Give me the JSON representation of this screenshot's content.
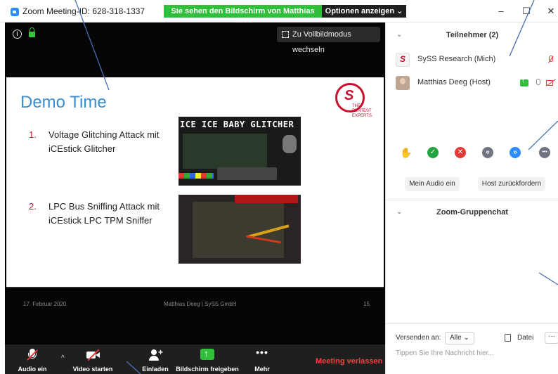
{
  "window": {
    "title": "Zoom Meeting-ID: 628-318-1337",
    "share_banner": "Sie sehen den Bildschirm von Matthias Deeg",
    "options_button": "Optionen anzeigen ⌄",
    "minimize": "–",
    "maximize": "☐",
    "close": "✕"
  },
  "stage": {
    "fullscreen_button": "Zu Vollbildmodus wechseln",
    "info_glyph": "i"
  },
  "slide": {
    "title": "Demo Time",
    "logo_mark": "S",
    "logo_text": "THE PENTEST EXPERTS.",
    "items": [
      {
        "num": "1.",
        "text": "Voltage Glitching Attack mit iCEstick Glitcher"
      },
      {
        "num": "2.",
        "text": "LPC Bus Sniffing Attack mit iCEstick LPC TPM Sniffer"
      }
    ],
    "screenshot1_text": "ICE ICE BABY GLITCHER",
    "footer_left": "17. Februar 2020",
    "footer_center": "Matthias Deeg | SySS GmbH",
    "footer_right": "15"
  },
  "toolbar": {
    "audio": "Audio ein",
    "video": "Video starten",
    "invite": "Einladen",
    "share": "Bildschirm freigeben",
    "more": "Mehr",
    "more_glyph": "•••",
    "caret": "^",
    "leave": "Meeting verlassen"
  },
  "participants": {
    "chevron": "⌄",
    "header": "Teilnehmer (2)",
    "list": [
      {
        "name": "SySS Research (Mich)"
      },
      {
        "name": "Matthias Deeg (Host)"
      }
    ]
  },
  "reactions": {
    "hand": "✋",
    "yes": "✓",
    "no": "✕",
    "slower": "«",
    "faster": "»",
    "more": "•••"
  },
  "panel_buttons": {
    "audio_on": "Mein Audio ein",
    "reclaim_host": "Host zurückfordern"
  },
  "chat": {
    "chevron": "⌄",
    "header": "Zoom-Gruppenchat",
    "send_to_label": "Versenden an:",
    "send_to_value": "Alle ⌄",
    "file_label": "Datei",
    "more_glyph": "···",
    "placeholder": "Tippen Sie Ihre Nachricht hier..."
  }
}
